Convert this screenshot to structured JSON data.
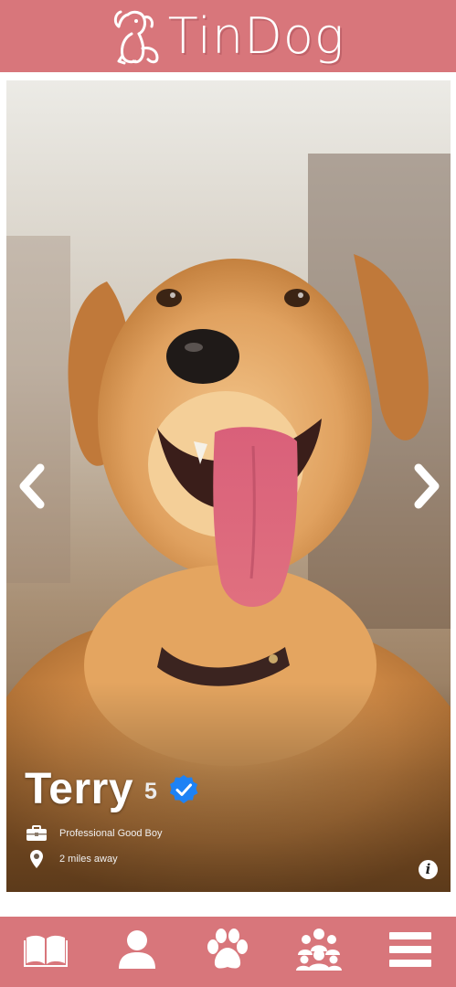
{
  "app": {
    "brand_name": "TinDog",
    "logo_icon": "dog-outline-icon",
    "brand_color": "#d8767b"
  },
  "profile": {
    "name": "Terry",
    "age": "5",
    "verified_icon": "verified-check-icon",
    "verified_color": "#1d82f5",
    "job": "Professional Good Boy",
    "job_icon": "briefcase-icon",
    "distance": "2 miles away",
    "distance_icon": "location-pin-icon",
    "photo_subject": "golden-retriever-photo"
  },
  "card_controls": {
    "previous_icon": "chevron-left-icon",
    "next_icon": "chevron-right-icon",
    "info_label": "i"
  },
  "bottom_nav": {
    "items": [
      {
        "icon": "book-icon"
      },
      {
        "icon": "user-icon"
      },
      {
        "icon": "paw-icon"
      },
      {
        "icon": "group-icon"
      },
      {
        "icon": "menu-icon"
      }
    ]
  }
}
